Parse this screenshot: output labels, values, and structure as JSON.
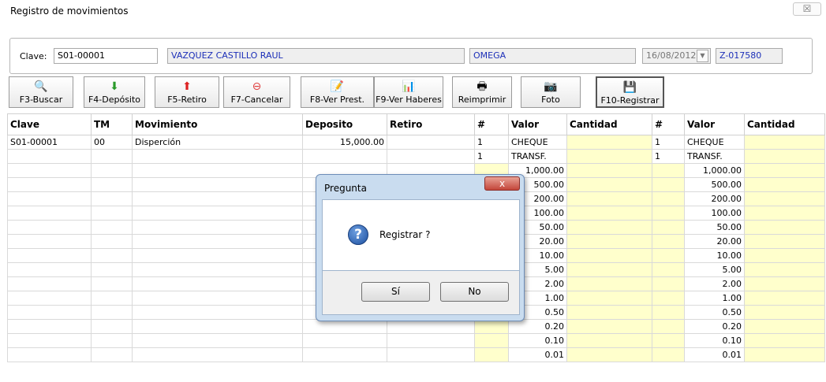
{
  "window": {
    "title": "Registro de movimientos",
    "close_glyph": "☒"
  },
  "header": {
    "clave_label": "Clave:",
    "clave_value": "S01-00001",
    "name": "VAZQUEZ CASTILLO RAUL",
    "company": "OMEGA",
    "date": "16/08/2012",
    "folio": "Z-017580"
  },
  "toolbar": [
    {
      "icon": "🔍",
      "label": "F3-Buscar"
    },
    {
      "icon": "⬇",
      "label": "F4-Depósito"
    },
    {
      "icon": "⬆",
      "label": "F5-Retiro"
    },
    {
      "icon": "⊖",
      "label": "F7-Cancelar"
    },
    {
      "icon": "📝",
      "label": "F8-Ver Prest."
    },
    {
      "icon": "📊",
      "label": "F9-Ver Haberes"
    },
    {
      "icon": "🖶",
      "label": "Reimprimir"
    },
    {
      "icon": "📷",
      "label": "Foto"
    },
    {
      "icon": "💾",
      "label": "F10-Registrar"
    }
  ],
  "movements": {
    "headers": [
      "Clave",
      "TM",
      "Movimiento",
      "Deposito",
      "Retiro"
    ],
    "rows": [
      [
        "S01-00001",
        "00",
        "Disperción",
        "15,000.00",
        ""
      ]
    ]
  },
  "denominations": {
    "headers": [
      "#",
      "Valor",
      "Cantidad"
    ],
    "rows": [
      [
        "1",
        "CHEQUE",
        ""
      ],
      [
        "1",
        "TRANSF.",
        ""
      ],
      [
        "",
        "1,000.00",
        ""
      ],
      [
        "",
        "500.00",
        ""
      ],
      [
        "",
        "200.00",
        ""
      ],
      [
        "",
        "100.00",
        ""
      ],
      [
        "",
        "50.00",
        ""
      ],
      [
        "",
        "20.00",
        ""
      ],
      [
        "",
        "10.00",
        ""
      ],
      [
        "",
        "5.00",
        ""
      ],
      [
        "",
        "2.00",
        ""
      ],
      [
        "",
        "1.00",
        ""
      ],
      [
        "",
        "0.50",
        ""
      ],
      [
        "",
        "0.20",
        ""
      ],
      [
        "",
        "0.10",
        ""
      ],
      [
        "",
        "0.01",
        ""
      ]
    ]
  },
  "dialog": {
    "title": "Pregunta",
    "close": "x",
    "icon": "?",
    "message": "Registrar ?",
    "yes": "Sí",
    "no": "No"
  }
}
